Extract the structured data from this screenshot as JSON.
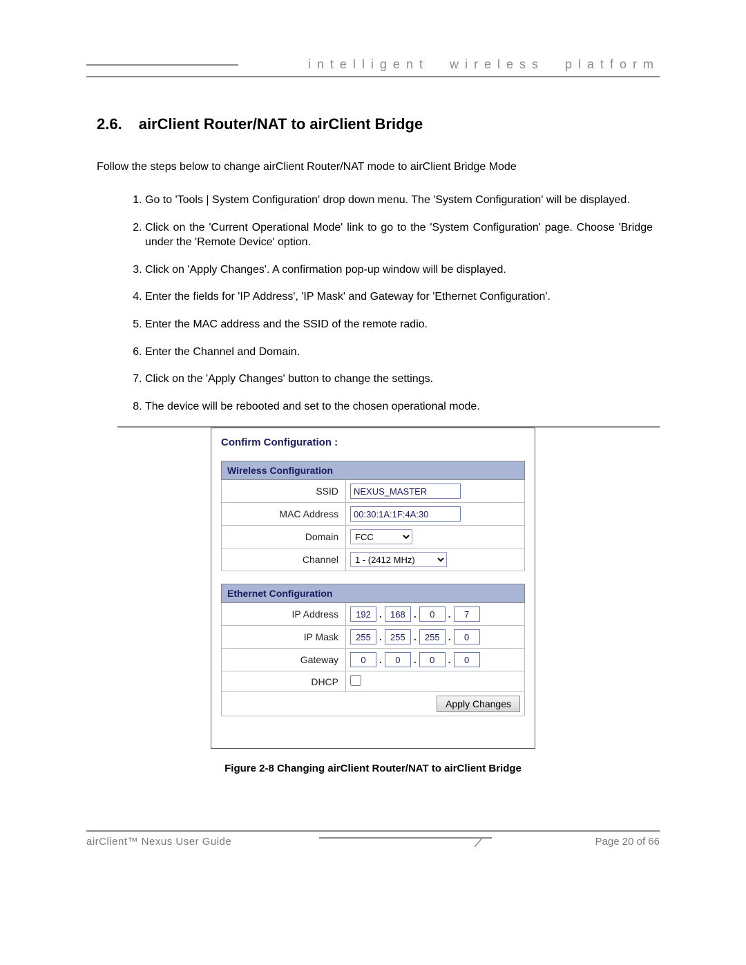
{
  "header": {
    "tagline": "intelligent wireless platform"
  },
  "section": {
    "number": "2.6.",
    "title": "airClient Router/NAT to airClient Bridge",
    "intro": "Follow the steps below to change airClient Router/NAT mode to airClient Bridge Mode",
    "steps": [
      "Go to 'Tools | System Configuration' drop down menu.  The 'System Configuration' will be displayed.",
      "Click on the 'Current Operational Mode' link to go to the 'System Configuration' page. Choose 'Bridge under the 'Remote Device' option.",
      "Click on 'Apply Changes'.  A confirmation pop-up window will be displayed.",
      "Enter the fields for 'IP Address', 'IP Mask' and Gateway for 'Ethernet Configuration'.",
      "Enter the MAC address and the SSID of the remote radio.",
      "Enter the Channel and Domain.",
      "Click on the 'Apply Changes' button to change the settings.",
      "The device will be rebooted and set to the chosen operational mode."
    ]
  },
  "panel": {
    "title": "Confirm Configuration :",
    "wireless_header": "Wireless Configuration",
    "ethernet_header": "Ethernet Configuration",
    "labels": {
      "ssid": "SSID",
      "mac": "MAC Address",
      "domain": "Domain",
      "channel": "Channel",
      "ip": "IP Address",
      "mask": "IP Mask",
      "gateway": "Gateway",
      "dhcp": "DHCP"
    },
    "values": {
      "ssid": "NEXUS_MASTER",
      "mac": "00:30:1A:1F:4A:30",
      "domain": "FCC",
      "channel": "1 - (2412 MHz)",
      "ip": [
        "192",
        "168",
        "0",
        "7"
      ],
      "mask": [
        "255",
        "255",
        "255",
        "0"
      ],
      "gateway": [
        "0",
        "0",
        "0",
        "0"
      ],
      "dhcp_checked": false
    },
    "apply_label": "Apply Changes"
  },
  "figure_caption": "Figure 2-8 Changing airClient Router/NAT to airClient Bridge",
  "footer": {
    "guide": "airClient™ Nexus User Guide",
    "page": "Page 20 of 66"
  }
}
